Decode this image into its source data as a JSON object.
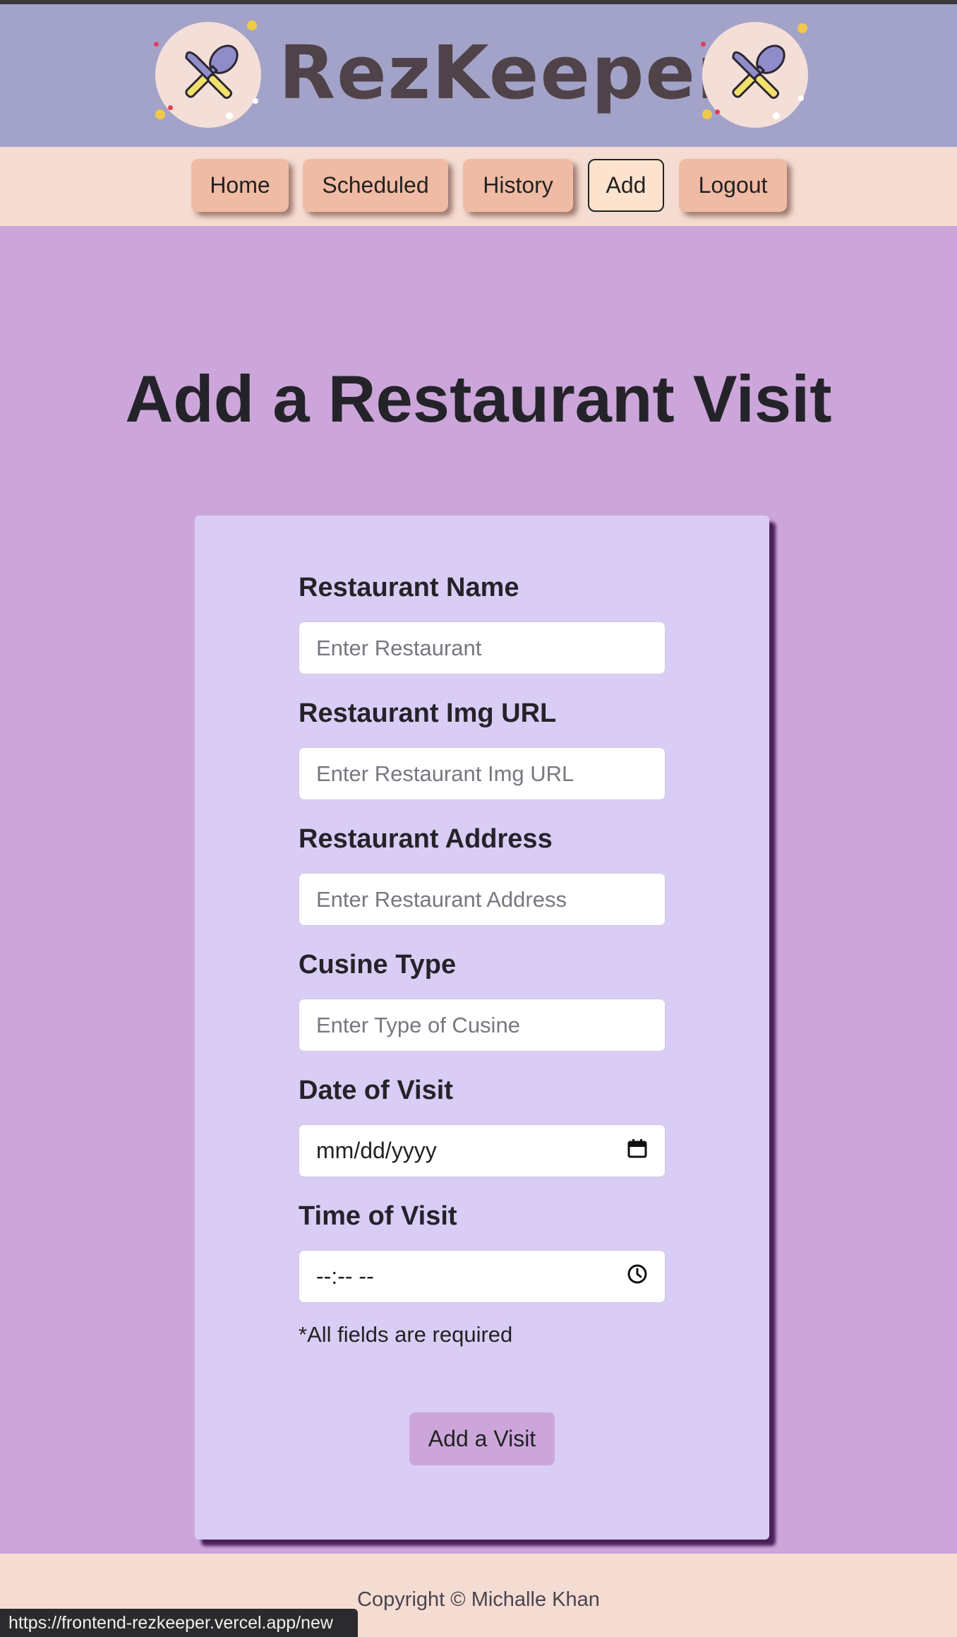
{
  "header": {
    "brand": "RezKeeper",
    "logo_icon": "crossed-knife-spoon-icon",
    "colors": {
      "background": "#a3a3c9",
      "brand_text": "#4f4349",
      "logo_circle": "#f4dfd8"
    }
  },
  "nav": {
    "items": [
      {
        "label": "Home",
        "active": false
      },
      {
        "label": "Scheduled",
        "active": false
      },
      {
        "label": "History",
        "active": false
      },
      {
        "label": "Add",
        "active": true
      },
      {
        "label": "Logout",
        "active": false
      }
    ],
    "colors": {
      "background": "#f4dcd2",
      "button": "#f0bba4",
      "active_button": "#fde2ce"
    }
  },
  "main": {
    "title": "Add a Restaurant Visit",
    "background": "#cca6da"
  },
  "form": {
    "fields": [
      {
        "label": "Restaurant Name",
        "placeholder": "Enter Restaurant"
      },
      {
        "label": "Restaurant Img URL",
        "placeholder": "Enter Restaurant Img URL"
      },
      {
        "label": "Restaurant Address",
        "placeholder": "Enter Restaurant Address"
      },
      {
        "label": "Cusine Type",
        "placeholder": "Enter Type of Cusine"
      },
      {
        "label": "Date of Visit",
        "value": "mm/dd/yyyy",
        "icon": "calendar-icon"
      },
      {
        "label": "Time of Visit",
        "value": "--:-- --",
        "icon": "clock-icon"
      }
    ],
    "required_note": "*All fields are required",
    "submit_label": "Add a Visit",
    "colors": {
      "card": "#dacdf5",
      "submit": "#cca6da"
    }
  },
  "footer": {
    "copyright": "Copyright © Michalle Khan"
  },
  "status_bar": {
    "url": "https://frontend-rezkeeper.vercel.app/new"
  }
}
